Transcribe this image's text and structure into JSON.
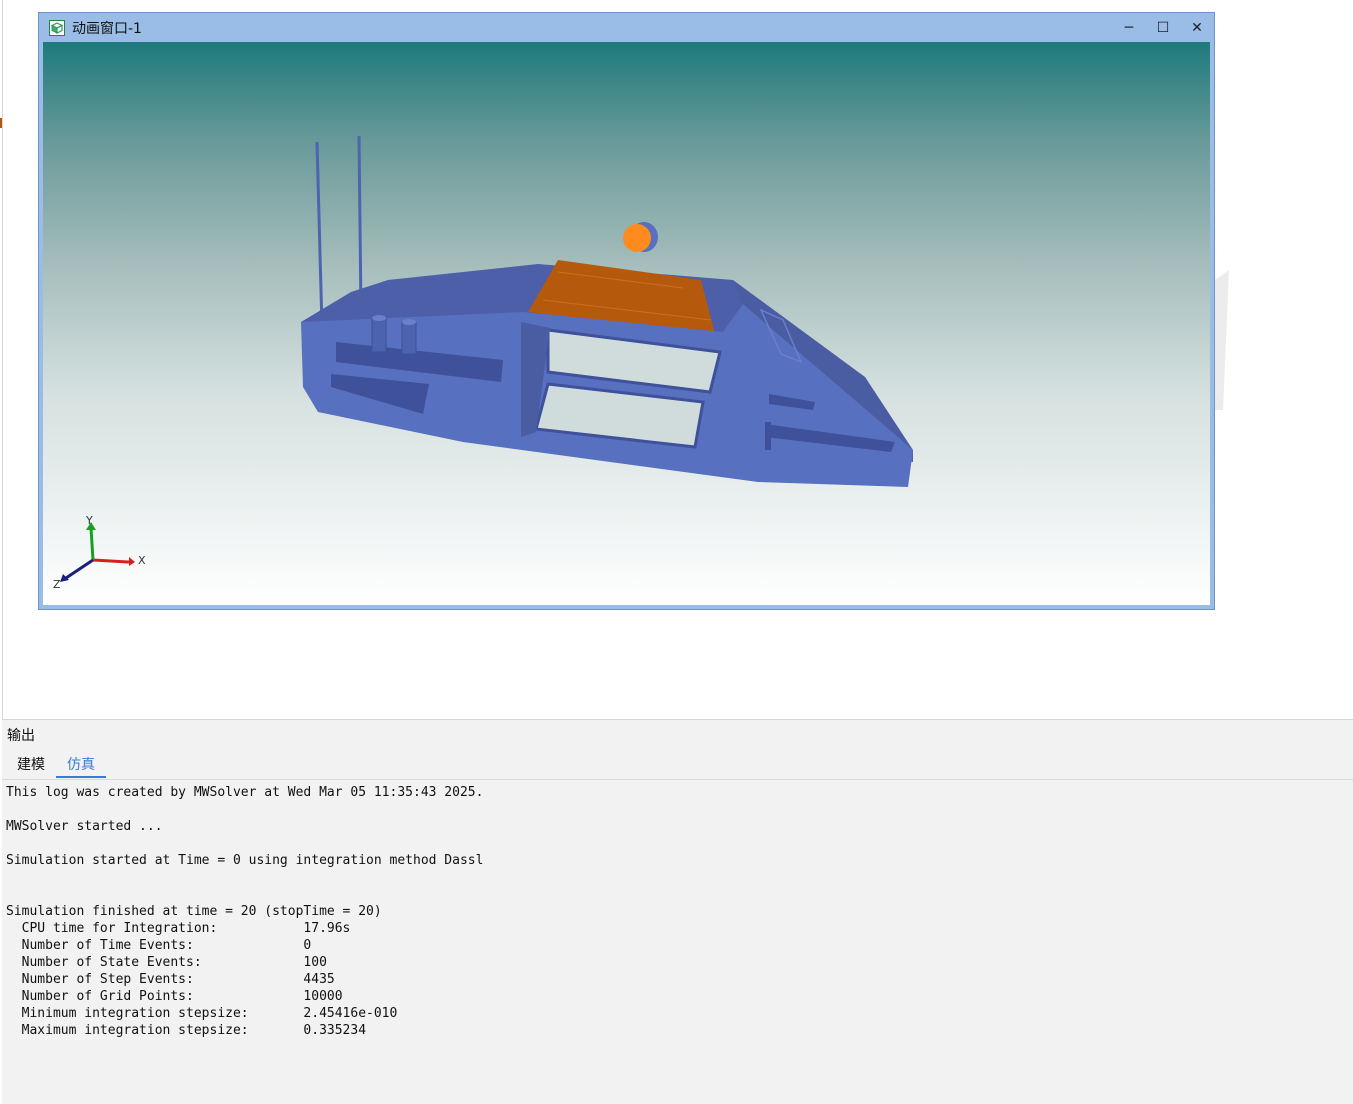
{
  "window": {
    "title": "动画窗口-1",
    "controls": {
      "minimize": "─",
      "maximize": "☐",
      "close": "✕"
    }
  },
  "viewport": {
    "axes": {
      "x": "X",
      "y": "Y",
      "z": "Z"
    }
  },
  "output": {
    "title": "输出",
    "tabs": [
      {
        "label": "建模"
      },
      {
        "label": "仿真",
        "active": true
      }
    ],
    "log_lines": [
      "This log was created by MWSolver at Wed Mar 05 11:35:43 2025.",
      "",
      "MWSolver started ...",
      "",
      "Simulation started at Time = 0 using integration method Dassl",
      "",
      "",
      "Simulation finished at time = 20 (stopTime = 20)",
      "  CPU time for Integration:           17.96s",
      "  Number of Time Events:              0",
      "  Number of State Events:             100",
      "  Number of Step Events:              4435",
      "  Number of Grid Points:              10000",
      "  Minimum integration stepsize:       2.45416e-010",
      "  Maximum integration stepsize:       0.335234"
    ]
  },
  "colors": {
    "hull": "#5870c0",
    "hull_dark": "#4a5fa6",
    "deck": "#b55a0c",
    "ball": "#ff8a1e",
    "tab_active": "#3a7bd5"
  }
}
